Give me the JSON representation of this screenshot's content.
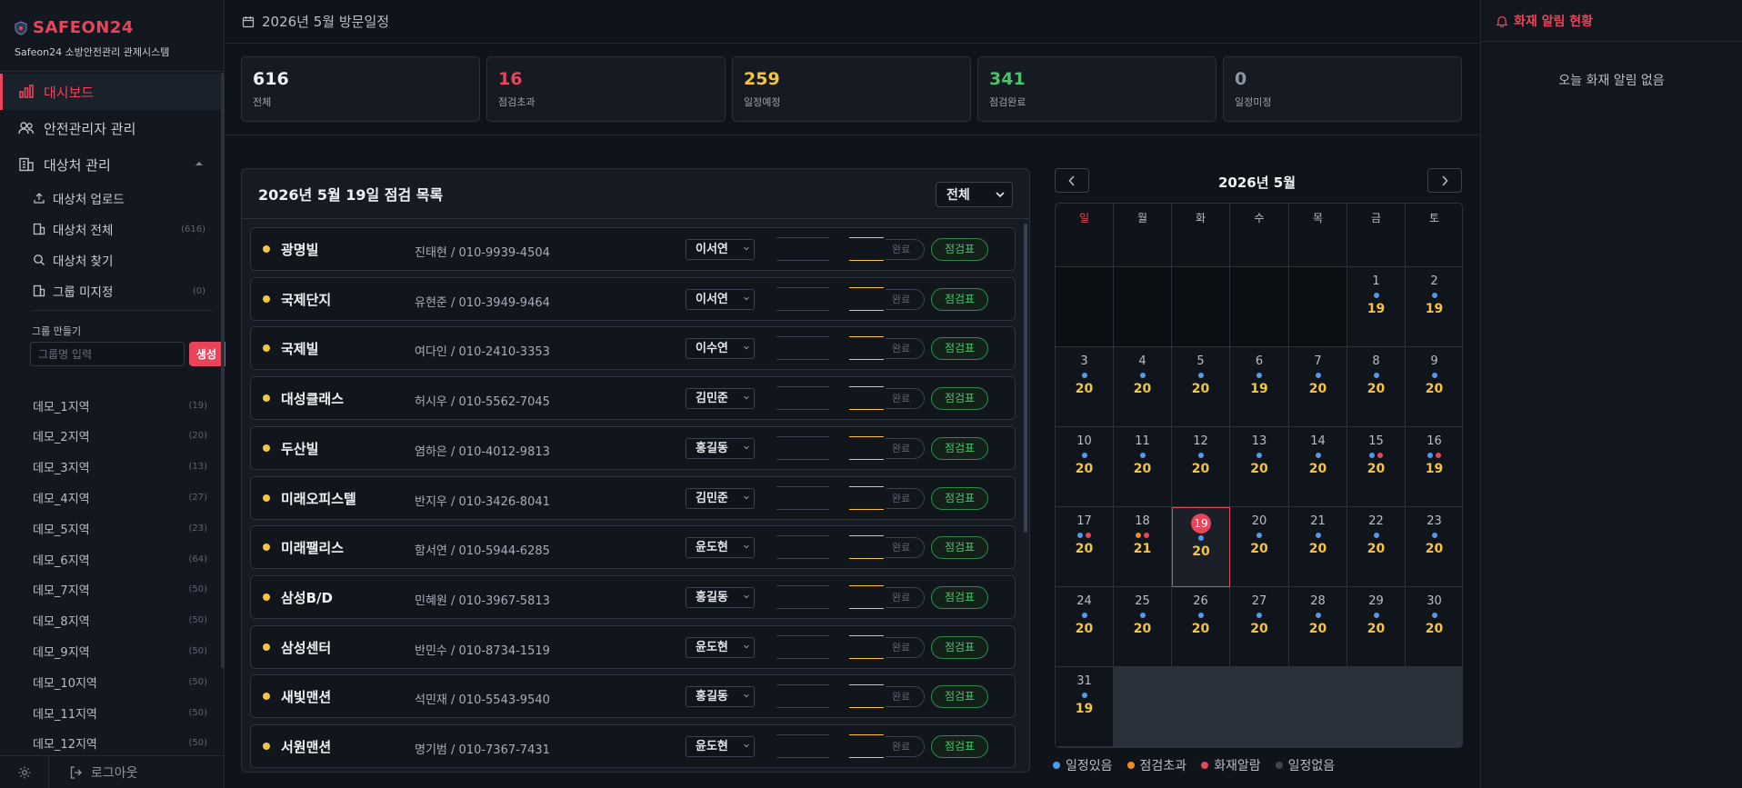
{
  "brand": {
    "name": "SAFEON24",
    "subtitle": "Safeon24 소방안전관리 관제시스템"
  },
  "nav": {
    "dashboard": "대시보드",
    "managers": "안전관리자 관리",
    "targets": "대상처 관리"
  },
  "subnav": [
    {
      "label": "대상처 업로드",
      "count": ""
    },
    {
      "label": "대상처 전체",
      "count": "(616)"
    },
    {
      "label": "대상처 찾기",
      "count": ""
    },
    {
      "label": "그룹 미지정",
      "count": "(0)"
    }
  ],
  "group": {
    "label": "그룹 만들기",
    "placeholder": "그룹명 입력",
    "button": "생성"
  },
  "regions": [
    {
      "label": "데모_1지역",
      "count": "(19)"
    },
    {
      "label": "데모_2지역",
      "count": "(20)"
    },
    {
      "label": "데모_3지역",
      "count": "(13)"
    },
    {
      "label": "데모_4지역",
      "count": "(27)"
    },
    {
      "label": "데모_5지역",
      "count": "(23)"
    },
    {
      "label": "데모_6지역",
      "count": "(64)"
    },
    {
      "label": "데모_7지역",
      "count": "(50)"
    },
    {
      "label": "데모_8지역",
      "count": "(50)"
    },
    {
      "label": "데모_9지역",
      "count": "(50)"
    },
    {
      "label": "데모_10지역",
      "count": "(50)"
    },
    {
      "label": "데모_11지역",
      "count": "(50)"
    },
    {
      "label": "데모_12지역",
      "count": "(50)"
    }
  ],
  "logout": "로그아웃",
  "topbar": {
    "title": "2026년 5월 방문일정"
  },
  "stats": [
    {
      "value": "616",
      "label": "전체",
      "color": "#f0f2f5"
    },
    {
      "value": "16",
      "label": "점검초과",
      "color": "#e8455a"
    },
    {
      "value": "259",
      "label": "일정예정",
      "color": "#f5c542"
    },
    {
      "value": "341",
      "label": "점검완료",
      "color": "#4cc26d"
    },
    {
      "value": "0",
      "label": "일정미정",
      "color": "#8e96a3"
    }
  ],
  "list": {
    "title": "2026년 5월 19일 점검 목록",
    "filter": "전체",
    "done_label": "완료",
    "check_label": "점검표",
    "rows": [
      {
        "name": "광명빌",
        "contact": "진태현 / 010-9939-4504",
        "manager": "이서연"
      },
      {
        "name": "국제단지",
        "contact": "유현준 / 010-3949-9464",
        "manager": "이서연"
      },
      {
        "name": "국제빌",
        "contact": "여다인 / 010-2410-3353",
        "manager": "이수연"
      },
      {
        "name": "대성클래스",
        "contact": "허시우 / 010-5562-7045",
        "manager": "김민준"
      },
      {
        "name": "두산빌",
        "contact": "염하은 / 010-4012-9813",
        "manager": "홍길동"
      },
      {
        "name": "미래오피스텔",
        "contact": "반지우 / 010-3426-8041",
        "manager": "김민준"
      },
      {
        "name": "미래팰리스",
        "contact": "함서연 / 010-5944-6285",
        "manager": "윤도현"
      },
      {
        "name": "삼성B/D",
        "contact": "민혜원 / 010-3967-5813",
        "manager": "홍길동"
      },
      {
        "name": "삼성센터",
        "contact": "반민수 / 010-8734-1519",
        "manager": "윤도현"
      },
      {
        "name": "새빛맨션",
        "contact": "석민재 / 010-5543-9540",
        "manager": "홍길동"
      },
      {
        "name": "서원맨션",
        "contact": "명기범 / 010-7367-7431",
        "manager": "윤도현"
      }
    ]
  },
  "calendar": {
    "title": "2026년 5월",
    "weekdays": [
      "일",
      "월",
      "화",
      "수",
      "목",
      "금",
      "토"
    ],
    "today": 19,
    "first_weekday": 5,
    "days": [
      {
        "d": 1,
        "c": "19",
        "dots": [
          "blue"
        ]
      },
      {
        "d": 2,
        "c": "19",
        "dots": [
          "blue"
        ]
      },
      {
        "d": 3,
        "c": "20",
        "dots": [
          "blue"
        ]
      },
      {
        "d": 4,
        "c": "20",
        "dots": [
          "blue"
        ]
      },
      {
        "d": 5,
        "c": "20",
        "dots": [
          "blue"
        ]
      },
      {
        "d": 6,
        "c": "19",
        "dots": [
          "blue"
        ]
      },
      {
        "d": 7,
        "c": "20",
        "dots": [
          "blue"
        ]
      },
      {
        "d": 8,
        "c": "20",
        "dots": [
          "blue"
        ]
      },
      {
        "d": 9,
        "c": "20",
        "dots": [
          "blue"
        ]
      },
      {
        "d": 10,
        "c": "20",
        "dots": [
          "blue"
        ]
      },
      {
        "d": 11,
        "c": "20",
        "dots": [
          "blue"
        ]
      },
      {
        "d": 12,
        "c": "20",
        "dots": [
          "blue"
        ]
      },
      {
        "d": 13,
        "c": "20",
        "dots": [
          "blue"
        ]
      },
      {
        "d": 14,
        "c": "20",
        "dots": [
          "blue"
        ]
      },
      {
        "d": 15,
        "c": "20",
        "dots": [
          "blue",
          "red"
        ]
      },
      {
        "d": 16,
        "c": "19",
        "dots": [
          "blue",
          "red"
        ]
      },
      {
        "d": 17,
        "c": "20",
        "dots": [
          "blue",
          "red"
        ]
      },
      {
        "d": 18,
        "c": "21",
        "dots": [
          "orange",
          "red"
        ]
      },
      {
        "d": 19,
        "c": "20",
        "dots": [
          "blue"
        ]
      },
      {
        "d": 20,
        "c": "20",
        "dots": [
          "blue"
        ]
      },
      {
        "d": 21,
        "c": "20",
        "dots": [
          "blue"
        ]
      },
      {
        "d": 22,
        "c": "20",
        "dots": [
          "blue"
        ]
      },
      {
        "d": 23,
        "c": "20",
        "dots": [
          "blue"
        ]
      },
      {
        "d": 24,
        "c": "20",
        "dots": [
          "blue"
        ]
      },
      {
        "d": 25,
        "c": "20",
        "dots": [
          "blue"
        ]
      },
      {
        "d": 26,
        "c": "20",
        "dots": [
          "blue"
        ]
      },
      {
        "d": 27,
        "c": "20",
        "dots": [
          "blue"
        ]
      },
      {
        "d": 28,
        "c": "20",
        "dots": [
          "blue"
        ]
      },
      {
        "d": 29,
        "c": "20",
        "dots": [
          "blue"
        ]
      },
      {
        "d": 30,
        "c": "20",
        "dots": [
          "blue"
        ]
      },
      {
        "d": 31,
        "c": "19",
        "dots": [
          "blue"
        ]
      }
    ],
    "legend": [
      {
        "label": "일정있음",
        "color": "#4d9bf0"
      },
      {
        "label": "점검초과",
        "color": "#f0882e"
      },
      {
        "label": "화재알람",
        "color": "#e8455a"
      },
      {
        "label": "일정없음",
        "color": "#3f4651"
      }
    ]
  },
  "alerts": {
    "title": "화재 알림 현황",
    "empty": "오늘 화재 알림 없음"
  },
  "colors": {
    "accent": "#e8455a",
    "blue": "#4d9bf0",
    "orange": "#f0882e",
    "red": "#e8455a",
    "yellow": "#f5c542",
    "green": "#4cc26d"
  }
}
